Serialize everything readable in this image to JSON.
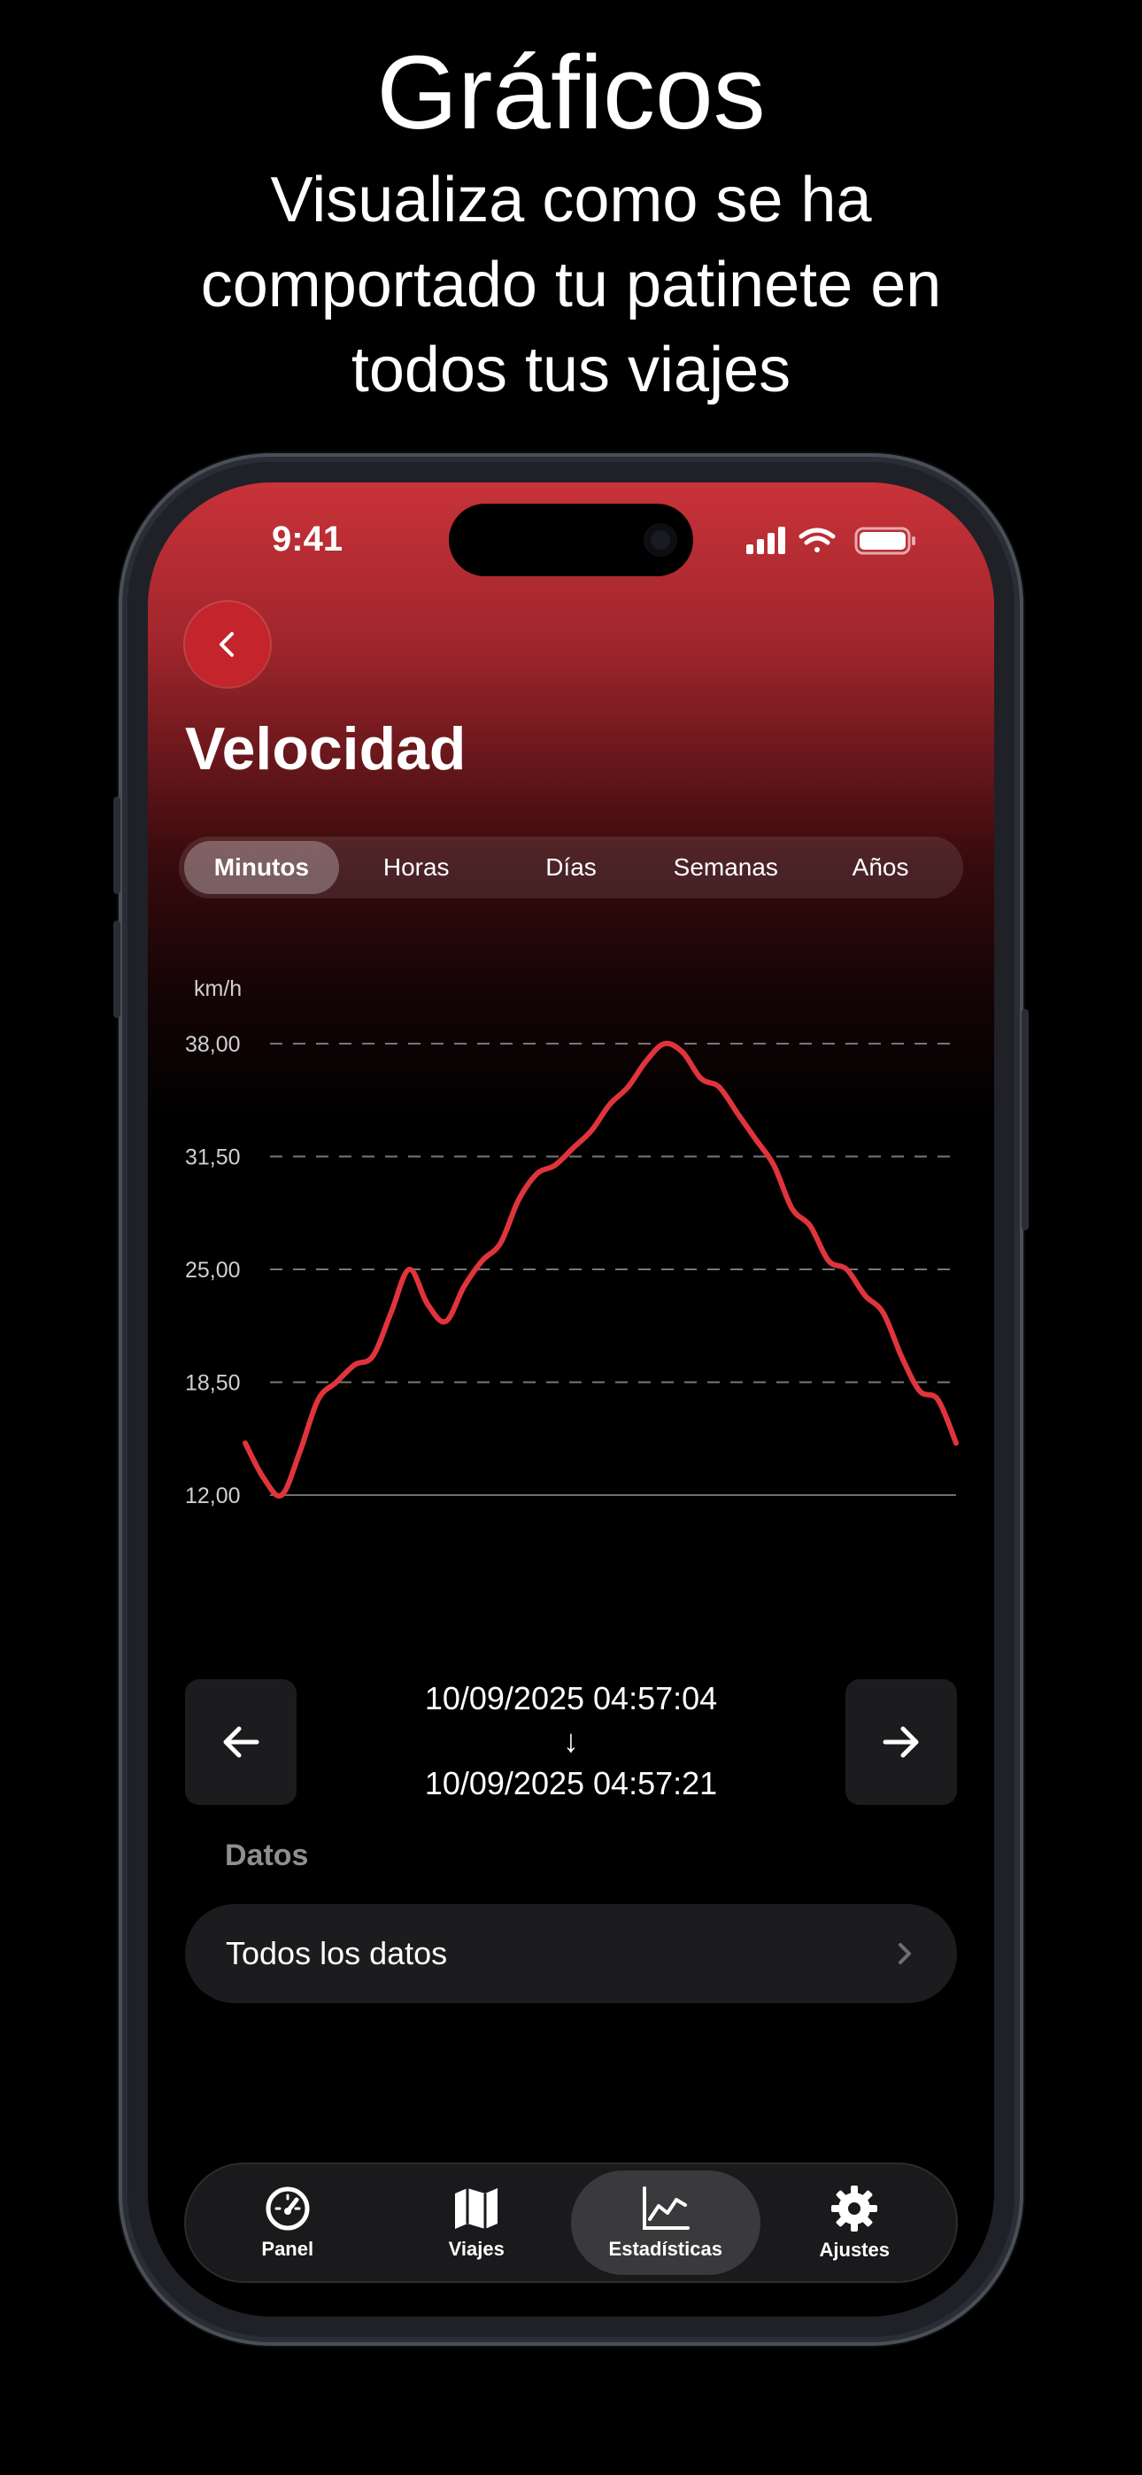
{
  "promo": {
    "title": "Gráficos",
    "subtitle": "Visualiza como se ha comportado tu patinete en todos tus viajes"
  },
  "status_bar": {
    "time": "9:41"
  },
  "header": {
    "title": "Velocidad"
  },
  "segments": {
    "items": [
      "Minutos",
      "Horas",
      "Días",
      "Semanas",
      "Años"
    ],
    "selected": "Minutos"
  },
  "chart_data": {
    "type": "line",
    "ylabel": "km/h",
    "y_ticks": [
      "38,00",
      "31,50",
      "25,00",
      "18,50",
      "12,00"
    ],
    "y_tick_values": [
      38,
      31.5,
      25,
      18.5,
      12
    ],
    "ylim": [
      12,
      38
    ],
    "grid": "dashed horizontal",
    "color": "#e0343d",
    "series": [
      {
        "values": [
          15.0,
          13.0,
          12.0,
          14.5,
          17.5,
          18.5,
          19.5,
          20.0,
          22.5,
          25.0,
          23.0,
          22.0,
          24.0,
          25.5,
          26.5,
          29.0,
          30.5,
          31.0,
          32.0,
          33.0,
          34.5,
          35.5,
          37.0,
          38.0,
          37.5,
          36.0,
          35.5,
          34.0,
          32.5,
          31.0,
          28.5,
          27.5,
          25.5,
          25.0,
          23.5,
          22.5,
          20.0,
          18.0,
          17.5,
          15.0
        ]
      }
    ]
  },
  "range": {
    "start": "10/09/2025 04:57:04",
    "arrow": "↓",
    "end": "10/09/2025 04:57:21"
  },
  "data_section": {
    "label": "Datos",
    "all_data": "Todos los datos"
  },
  "tabbar": {
    "items": [
      {
        "label": "Panel",
        "icon": "speedometer-icon"
      },
      {
        "label": "Viajes",
        "icon": "map-icon"
      },
      {
        "label": "Estadísticas",
        "icon": "chart-icon"
      },
      {
        "label": "Ajustes",
        "icon": "gear-icon"
      }
    ],
    "selected": "Estadísticas"
  }
}
